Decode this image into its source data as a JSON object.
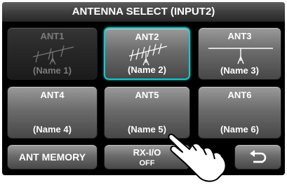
{
  "title": "ANTENNA SELECT (INPUT2)",
  "antennas": [
    {
      "label": "ANT1",
      "name": "(Name 1)",
      "state": "disabled",
      "icon": "yagi-antenna-icon"
    },
    {
      "label": "ANT2",
      "name": "(Name 2)",
      "state": "selected",
      "icon": "multi-element-antenna-icon"
    },
    {
      "label": "ANT3",
      "name": "(Name 3)",
      "state": "normal",
      "icon": "dipole-antenna-icon"
    },
    {
      "label": "ANT4",
      "name": "(Name 4)",
      "state": "normal"
    },
    {
      "label": "ANT5",
      "name": "(Name 5)",
      "state": "normal"
    },
    {
      "label": "ANT6",
      "name": "(Name 6)",
      "state": "normal"
    }
  ],
  "bottom": {
    "memory_label": "ANT MEMORY",
    "rxio_label": "RX-I/O",
    "rxio_value": "OFF",
    "back_icon": "return-arrow-icon"
  },
  "colors": {
    "selected_outline": "#19c7c9"
  }
}
